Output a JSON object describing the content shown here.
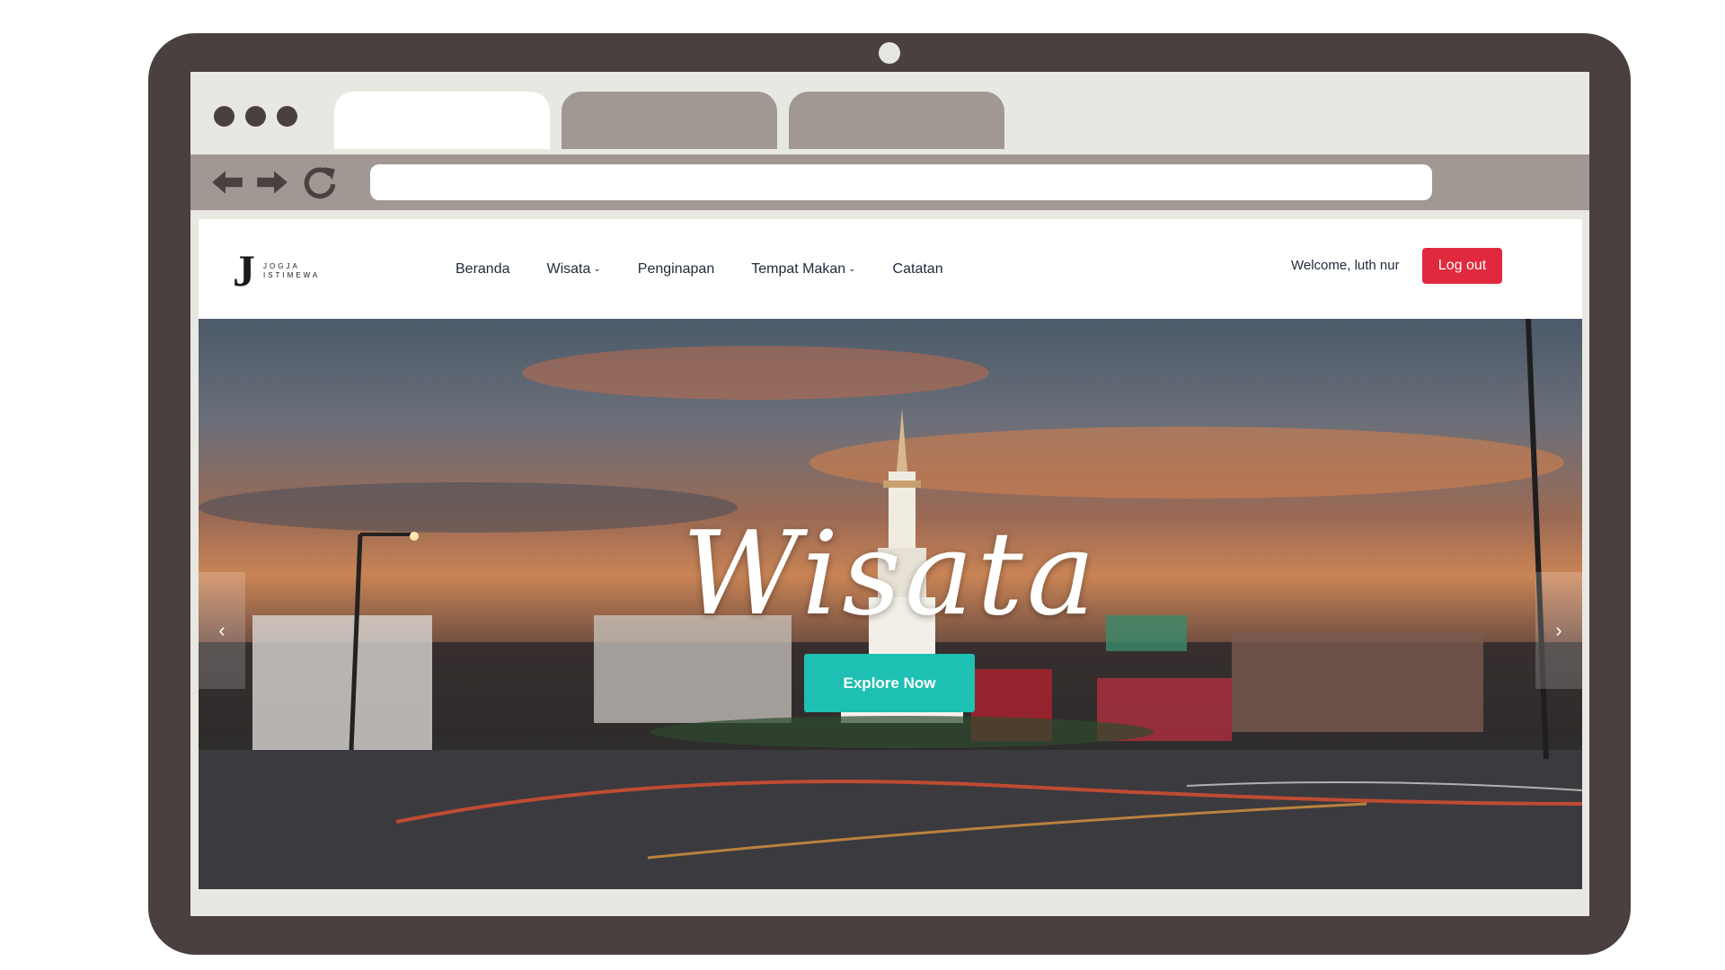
{
  "browser": {
    "address_value": ""
  },
  "site": {
    "logo": {
      "mark": "J",
      "line1": "JOGJA",
      "line2": "ISTIMEWA"
    },
    "nav": {
      "items": [
        {
          "label": "Beranda",
          "dropdown": false
        },
        {
          "label": "Wisata",
          "dropdown": true
        },
        {
          "label": "Penginapan",
          "dropdown": false
        },
        {
          "label": "Tempat Makan",
          "dropdown": true
        },
        {
          "label": "Catatan",
          "dropdown": false
        }
      ],
      "dropdown_icon": "chevron-down-icon"
    },
    "user": {
      "welcome": "Welcome, luth nur",
      "logout_label": "Log out"
    },
    "hero": {
      "title": "Wisata",
      "button_label": "Explore Now",
      "prev_icon": "chevron-left-icon",
      "next_icon": "chevron-right-icon"
    }
  },
  "colors": {
    "device_frame": "#4a4040",
    "browser_chrome": "#e8e8e3",
    "inactive_tab": "#a19893",
    "logout_red": "#e0293d",
    "explore_teal": "#1ec0b3"
  }
}
